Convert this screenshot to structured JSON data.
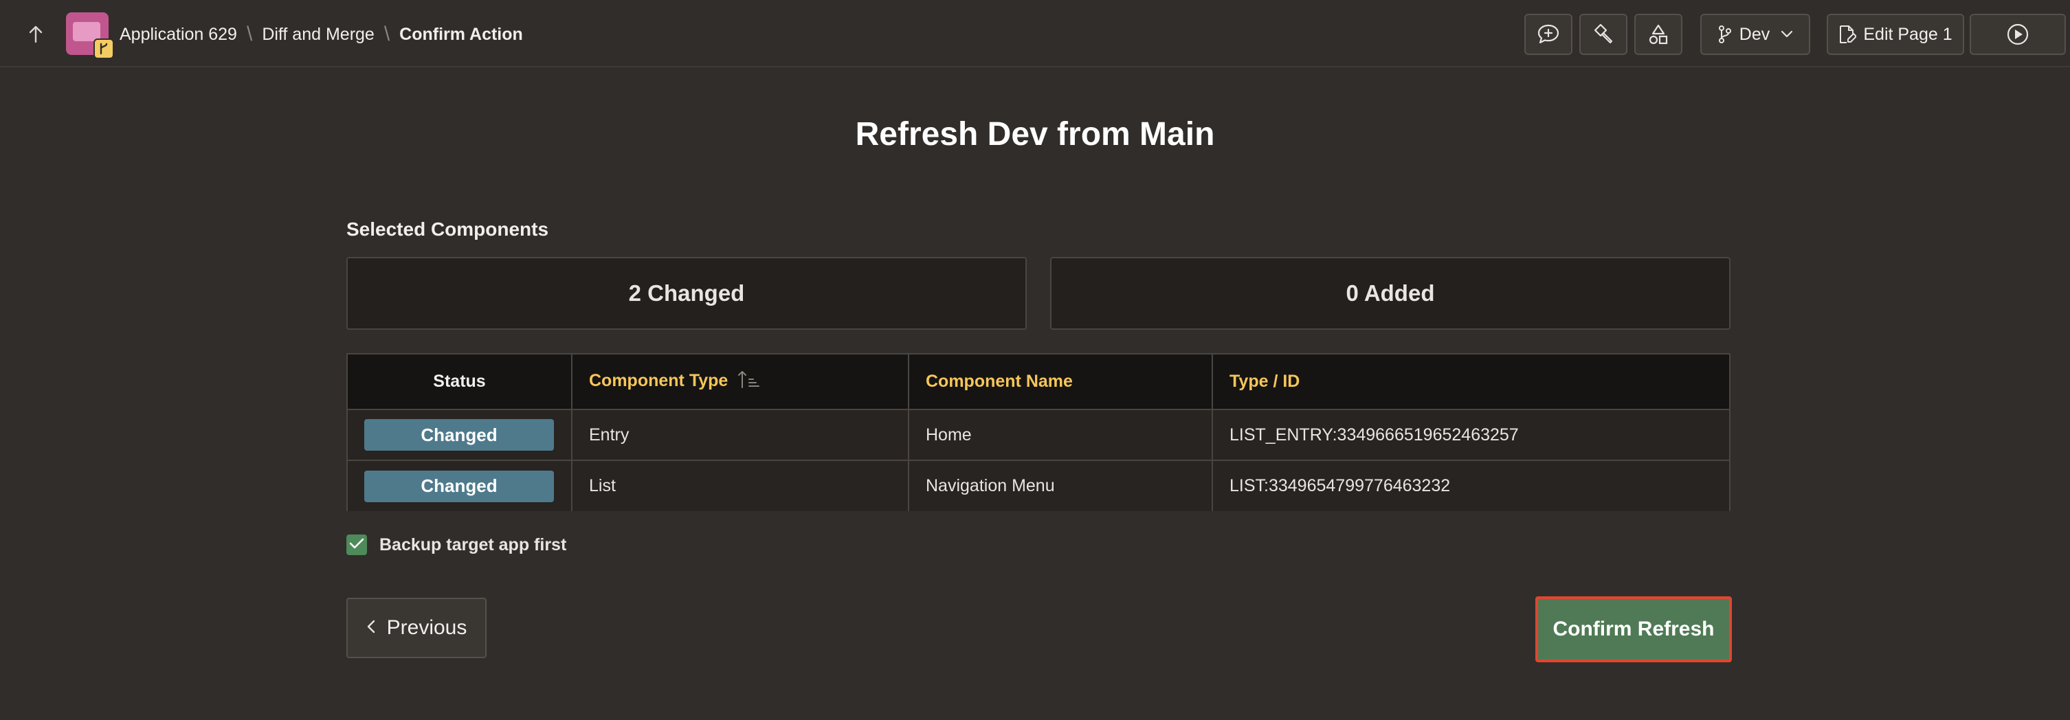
{
  "colors": {
    "background": "#312d2a",
    "accent_header": "#f6c65a",
    "changed_pill": "#4f7a8c",
    "confirm_button": "#4f7a55",
    "confirm_focus_border": "#e2452f",
    "app_icon": "#c1568e"
  },
  "topbar": {
    "up_icon": "arrow-up-icon",
    "breadcrumb": [
      "Application 629",
      "Diff and Merge",
      "Confirm Action"
    ],
    "toolbar": {
      "feedback_icon": "comment-add-icon",
      "developer_icon": "flashlight-icon",
      "shared_components_icon": "shapes-icon",
      "branch_label": "Dev",
      "edit_page_label": "Edit Page 1",
      "run_icon": "play-icon"
    }
  },
  "main": {
    "title": "Refresh Dev from Main",
    "section_label": "Selected Components",
    "summary": {
      "changed": "2 Changed",
      "added": "0 Added"
    },
    "table": {
      "headers": [
        "Status",
        "Component Type",
        "Component Name",
        "Type / ID"
      ],
      "rows": [
        {
          "status": "Changed",
          "component_type": "Entry",
          "component_name": "Home",
          "type_id": "LIST_ENTRY:3349666519652463257"
        },
        {
          "status": "Changed",
          "component_type": "List",
          "component_name": "Navigation Menu",
          "type_id": "LIST:3349654799776463232"
        }
      ]
    },
    "backup_checkbox": {
      "label": "Backup target app first",
      "checked": true
    },
    "previous_label": "Previous",
    "confirm_label": "Confirm Refresh"
  }
}
